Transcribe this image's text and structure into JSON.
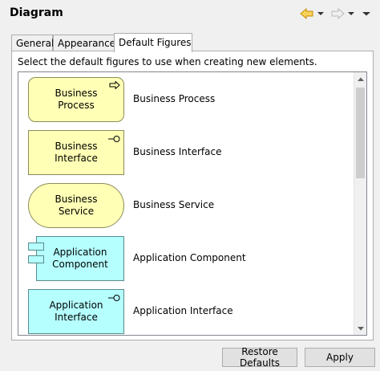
{
  "header": {
    "title": "Diagram",
    "icons": [
      "back-arrow-icon",
      "chevron-down-icon",
      "forward-arrow-icon",
      "chevron-down-icon",
      "view-menu-icon"
    ],
    "colors": {
      "back_arrow": "#e8a317",
      "disabled": "#c0c0c0"
    }
  },
  "tabs": [
    {
      "label": "General",
      "selected": false
    },
    {
      "label": "Appearance",
      "selected": false
    },
    {
      "label": "Default Figures",
      "selected": true
    }
  ],
  "panel": {
    "description": "Select the default figures to use when creating new elements.",
    "items": [
      {
        "figure_text": "Business\nProcess",
        "label": "Business Process",
        "shape": "rounded-rectangle",
        "icon": "process-arrow-icon",
        "fill": "#ffffb5"
      },
      {
        "figure_text": "Business\nInterface",
        "label": "Business Interface",
        "shape": "rectangle",
        "icon": "interface-lollipop-icon",
        "fill": "#ffffb5"
      },
      {
        "figure_text": "Business\nService",
        "label": "Business Service",
        "shape": "pill",
        "icon": "",
        "fill": "#ffffb5"
      },
      {
        "figure_text": "Application\nComponent",
        "label": "Application Component",
        "shape": "component",
        "icon": "component-tabs-icon",
        "fill": "#b5ffff"
      },
      {
        "figure_text": "Application\nInterface",
        "label": "Application Interface",
        "shape": "rectangle",
        "icon": "interface-lollipop-icon",
        "fill": "#b5ffff"
      }
    ]
  },
  "buttons": {
    "restore_defaults": "Restore Defaults",
    "apply": "Apply"
  }
}
